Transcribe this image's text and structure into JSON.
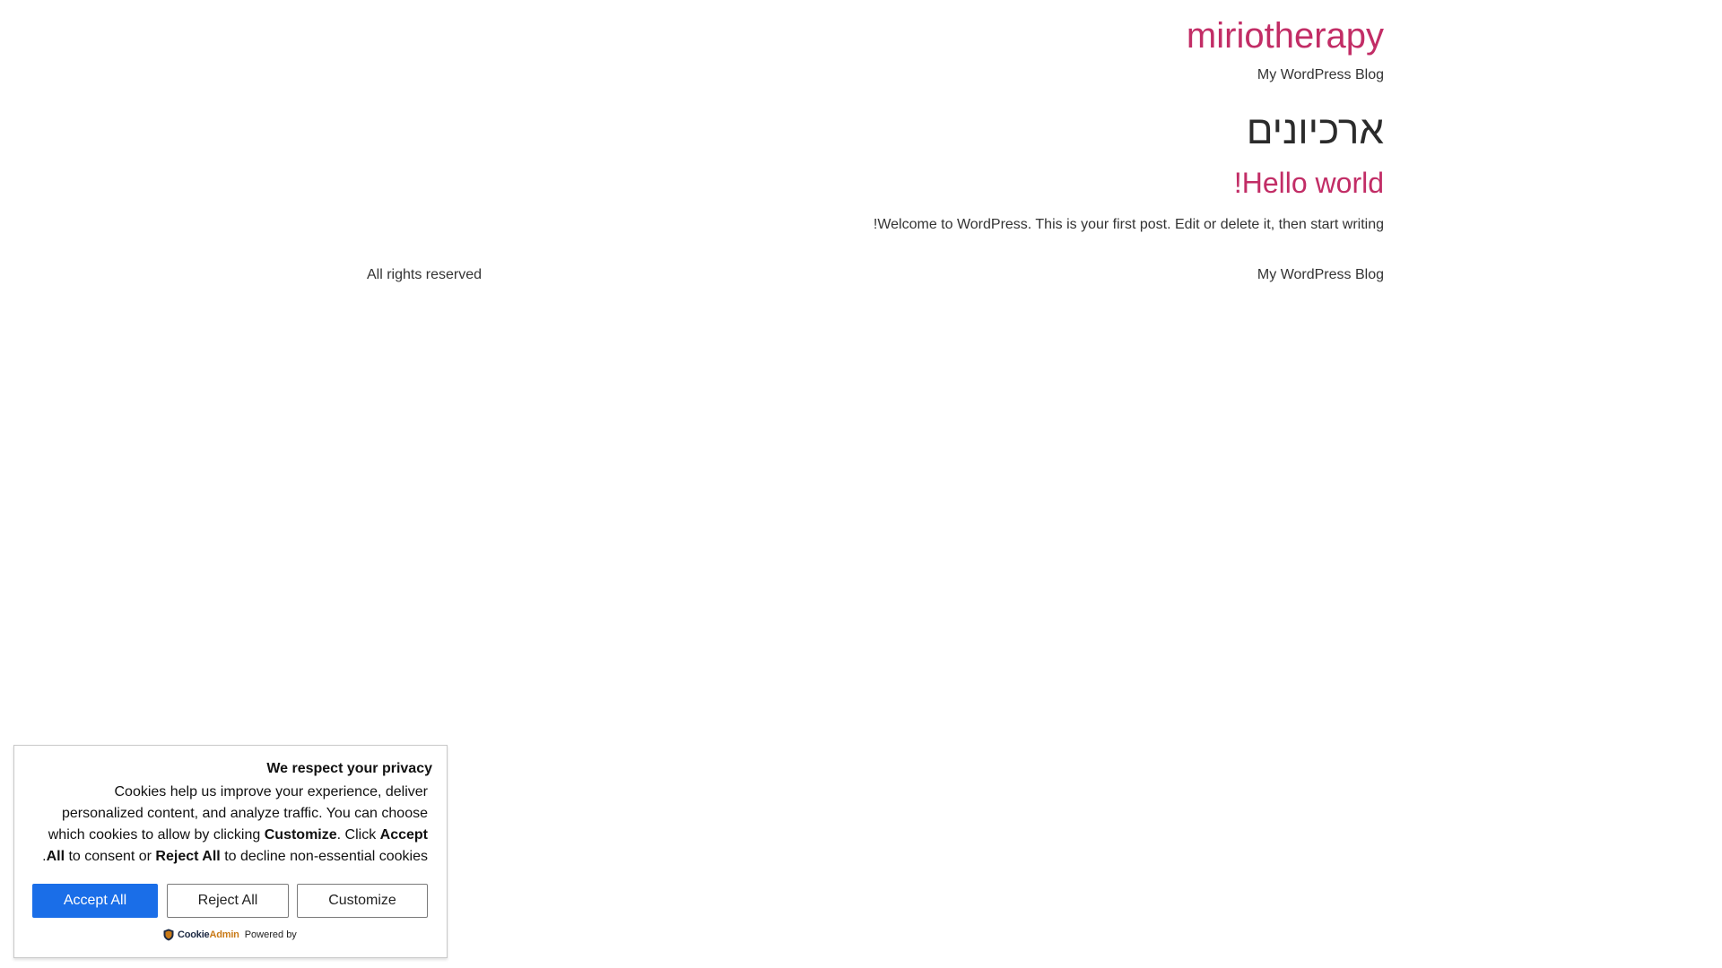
{
  "site": {
    "title": "miriotherapy",
    "tagline": "My WordPress Blog"
  },
  "archive": {
    "title": "ארכיונים"
  },
  "post": {
    "title": "Hello world!",
    "excerpt": "Welcome to WordPress. This is your first post. Edit or delete it, then start writing!"
  },
  "footer": {
    "blog_name": "My WordPress Blog",
    "rights": "All rights reserved"
  },
  "cookie_banner": {
    "title": "We respect your privacy",
    "text_part1": "Cookies help us improve your experience, deliver personalized content, and analyze traffic. You can choose which cookies to allow by clicking ",
    "text_bold_customize": "Customize",
    "text_part2": ". Click ",
    "text_bold_accept": "Accept All",
    "text_part3": " to consent or ",
    "text_bold_reject": "Reject All",
    "text_part4": " to decline non-essential cookies.",
    "accept_label": "Accept All",
    "reject_label": "Reject All",
    "customize_label": "Customize",
    "powered_by": "Powered by",
    "brand_cookie": "Cookie",
    "brand_admin": "Admin",
    "brand_shield_icon": "shield-icon"
  },
  "colors": {
    "accent": "#c22d66",
    "accept_button": "#1a6ee8",
    "brand_dark": "#1d2a44",
    "brand_orange": "#c97a17"
  }
}
